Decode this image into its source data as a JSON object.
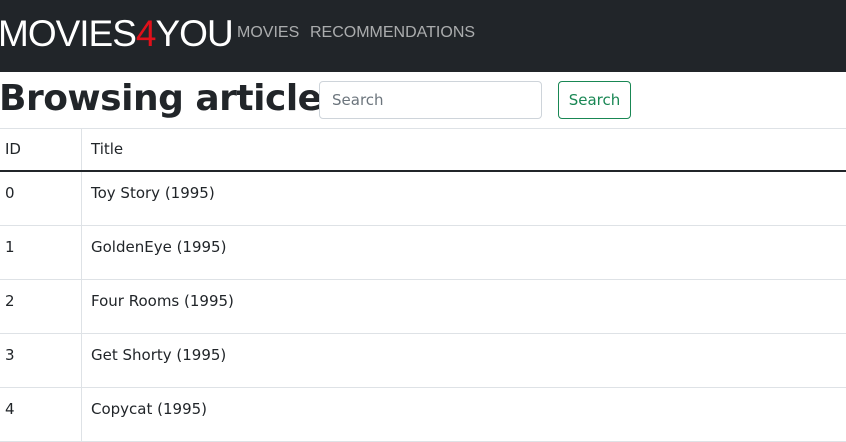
{
  "navbar": {
    "brand_prefix": "MOVIES",
    "brand_accent": "4",
    "brand_suffix": "YOU",
    "links": [
      "MOVIES",
      "RECOMMENDATIONS"
    ]
  },
  "colors": {
    "navbar_bg": "#212529",
    "brand_accent": "#e0101a",
    "search_button": "#198754"
  },
  "page": {
    "title": "Browsing articles"
  },
  "search": {
    "placeholder": "Search",
    "value": "",
    "button_label": "Search"
  },
  "table": {
    "headers": [
      "ID",
      "Title"
    ],
    "rows": [
      {
        "id": "0",
        "title": "Toy Story (1995)"
      },
      {
        "id": "1",
        "title": "GoldenEye (1995)"
      },
      {
        "id": "2",
        "title": "Four Rooms (1995)"
      },
      {
        "id": "3",
        "title": "Get Shorty (1995)"
      },
      {
        "id": "4",
        "title": "Copycat (1995)"
      }
    ]
  }
}
